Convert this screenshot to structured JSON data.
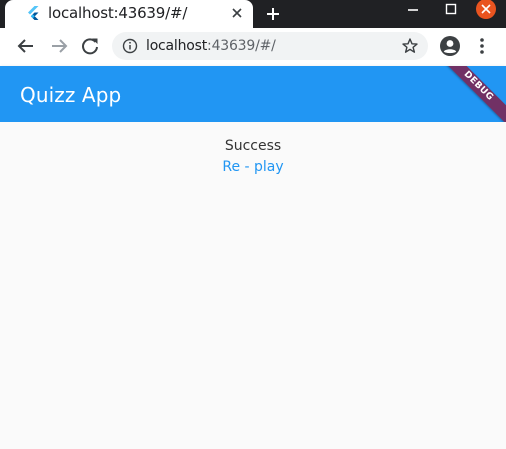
{
  "browser": {
    "tab_title": "localhost:43639/#/",
    "url_host": "localhost",
    "url_rest": ":43639/#/",
    "icons": {
      "favicon": "flutter-logo-icon",
      "tab_close": "close-icon",
      "new_tab": "plus-icon",
      "minimize": "minimize-icon",
      "maximize": "maximize-icon",
      "window_close": "close-icon",
      "back": "arrow-back-icon",
      "forward": "arrow-forward-icon",
      "reload": "reload-icon",
      "site_info": "info-icon",
      "bookmark": "star-icon",
      "profile": "account-icon",
      "menu": "more-vert-icon"
    }
  },
  "app": {
    "title": "Quizz App",
    "debug_banner": "DEBUG",
    "result_text": "Success",
    "replay_label": "Re - play",
    "colors": {
      "primary": "#2196f3",
      "background": "#fafafa",
      "window_close": "#e95420",
      "debug_banner": "#88143c"
    }
  }
}
